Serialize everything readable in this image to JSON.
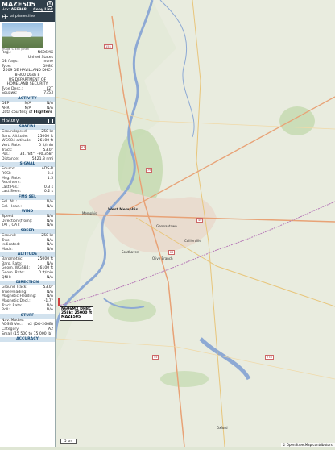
{
  "header": {
    "callsign": "MAZE505",
    "hex_label": "Hex:",
    "hex": "A6F968",
    "copy_link": "Copy Link",
    "site": "airplanes.live"
  },
  "photo": {
    "caption": "Image © Eric Jonah"
  },
  "info": [
    {
      "k": "Reg.:",
      "v": "N606MX"
    },
    {
      "k": "",
      "v": "United States"
    },
    {
      "k": "DB flags:",
      "v": "none"
    },
    {
      "k": "Type:",
      "v": "DH8C"
    }
  ],
  "aircraft_desc": "2009 DE HAVILLAND DHC-8-300 Dash 8",
  "operator": "US DEPARTMENT OF HOMELAND SECURITY",
  "info2": [
    {
      "k": "Type Desc.:",
      "v": "L2T"
    },
    {
      "k": "Squawk:",
      "v": "7353"
    }
  ],
  "activity": {
    "title": "ACTIVITY",
    "dep": {
      "k": "DEP",
      "a": "N/A",
      "b": "N/A"
    },
    "arr": {
      "k": "ARR",
      "a": "N/A",
      "b": "N/A"
    },
    "courtesy": "Data courtesy of",
    "courtesy_src": "Flighters"
  },
  "history": {
    "label": "History",
    "icon": "square-icon"
  },
  "spatial": {
    "title": "SPATIAL",
    "rows": [
      {
        "k": "Groundspeed:",
        "v": "258 kt"
      },
      {
        "k": "Baro. Altitude:",
        "v": "25000 ft"
      },
      {
        "k": "WGS84 altitude:",
        "v": "26100 ft"
      },
      {
        "k": "Vert. Rate:",
        "v": "0 ft/min"
      },
      {
        "k": "Track:",
        "v": "53.0°"
      },
      {
        "k": "Pos.:",
        "v": "34.784°, -90.358°"
      },
      {
        "k": "Distance:",
        "v": "5421.3 nmi"
      }
    ]
  },
  "signal": {
    "title": "SIGNAL",
    "rows": [
      {
        "k": "Source:",
        "v": "ADS-B"
      },
      {
        "k": "RSSI:",
        "v": "-3.4"
      },
      {
        "k": "Msg. Rate:",
        "v": "1.5"
      },
      {
        "k": "Receivers:",
        "v": ""
      },
      {
        "k": "Last Pos.:",
        "v": "0.3 s"
      },
      {
        "k": "Last Seen:",
        "v": "0.2 s"
      }
    ]
  },
  "fms": {
    "title": "FMS SEL",
    "rows": [
      {
        "k": "Sel. Alt.:",
        "v": "N/A"
      },
      {
        "k": "Sel. Head.:",
        "v": "N/A"
      }
    ]
  },
  "wind": {
    "title": "WIND",
    "rows": [
      {
        "k": "Speed:",
        "v": "N/A"
      },
      {
        "k": "Direction (from):",
        "v": "N/A"
      },
      {
        "k": "TAT / OAT:",
        "v": "N/A"
      }
    ]
  },
  "speed": {
    "title": "SPEED",
    "rows": [
      {
        "k": "Ground:",
        "v": "258 kt"
      },
      {
        "k": "True:",
        "v": "N/A"
      },
      {
        "k": "Indicated:",
        "v": "N/A"
      },
      {
        "k": "Mach:",
        "v": "N/A"
      }
    ]
  },
  "altitude": {
    "title": "ALTITUDE",
    "rows": [
      {
        "k": "Barometric:",
        "v": "25000 ft"
      },
      {
        "k": "Baro. Rate:",
        "v": "N/A"
      },
      {
        "k": "Geom. WGS84:",
        "v": "26100 ft"
      },
      {
        "k": "Geom. Rate:",
        "v": "0 ft/min"
      },
      {
        "k": "QNH:",
        "v": "N/A"
      }
    ]
  },
  "direction": {
    "title": "DIRECTION",
    "rows": [
      {
        "k": "Ground Track:",
        "v": "53.0°"
      },
      {
        "k": "True Heading:",
        "v": "N/A"
      },
      {
        "k": "Magnetic Heading:",
        "v": "N/A"
      },
      {
        "k": "Magnetic Decl.:",
        "v": "-1.7°"
      },
      {
        "k": "Track Rate:",
        "v": "N/A"
      },
      {
        "k": "Roll:",
        "v": "N/A"
      }
    ]
  },
  "stuff": {
    "title": "STUFF",
    "rows": [
      {
        "k": "Nav. Modes:",
        "v": ""
      },
      {
        "k": "ADS-B Ver.:",
        "v": "v2 (DO-260B)"
      },
      {
        "k": "Category:",
        "v": "A2"
      }
    ],
    "category_desc": "Small (15 500 to 75 000 lb)"
  },
  "accuracy": {
    "title": "ACCURACY"
  },
  "aircraft_label": {
    "line1": "N606MX DH8C",
    "line2": "258kt 25000 ft",
    "line3": "MAZE505"
  },
  "map": {
    "cities": [
      {
        "name": "Memphis"
      },
      {
        "name": "West Memphis"
      },
      {
        "name": "Germantown"
      },
      {
        "name": "Collierville"
      },
      {
        "name": "Southaven"
      },
      {
        "name": "Olive Branch"
      },
      {
        "name": "Oxford"
      }
    ],
    "scale": "5 km",
    "attribution": "© OpenStreetMap contributors."
  },
  "colors": {
    "panel_header": "#2f3e4a",
    "section_bg": "#d2e2ee",
    "section_text": "#1c4f7a",
    "river": "#8da9d4",
    "urban": "#e6d9cd"
  }
}
